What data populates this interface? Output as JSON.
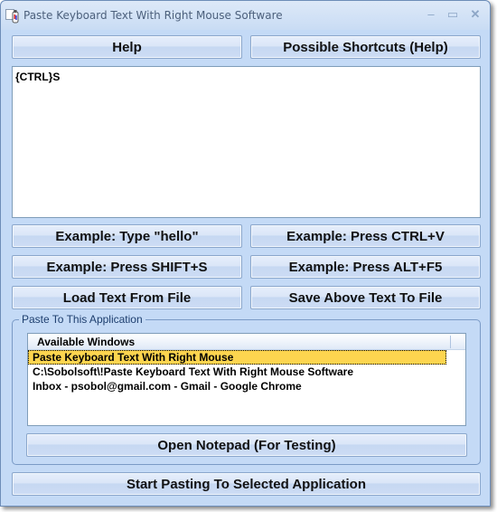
{
  "window": {
    "title": "Paste Keyboard Text With Right Mouse Software",
    "controls": {
      "minimize": "–",
      "maximize": "▭",
      "close": "✕"
    }
  },
  "buttons": {
    "help": "Help",
    "possible_shortcuts": "Possible Shortcuts (Help)",
    "example_type_hello": "Example: Type \"hello\"",
    "example_ctrl_v": "Example: Press CTRL+V",
    "example_shift_s": "Example: Press SHIFT+S",
    "example_alt_f5": "Example: Press ALT+F5",
    "load_text": "Load Text From File",
    "save_text": "Save Above Text To File",
    "open_notepad": "Open Notepad (For Testing)",
    "start_pasting": "Start Pasting To Selected Application"
  },
  "text_input": {
    "value": "{CTRL}S"
  },
  "paste_group": {
    "label": "Paste To This Application",
    "list_header": "Available Windows",
    "items": [
      {
        "label": "Paste Keyboard Text With Right Mouse",
        "selected": true
      },
      {
        "label": "C:\\Sobolsoft\\!Paste Keyboard Text With Right Mouse Software",
        "selected": false
      },
      {
        "label": "Inbox - psobol@gmail.com - Gmail - Google Chrome",
        "selected": false
      }
    ]
  },
  "colors": {
    "window_bg": "#c4daf6",
    "selection": "#fdd54f"
  }
}
